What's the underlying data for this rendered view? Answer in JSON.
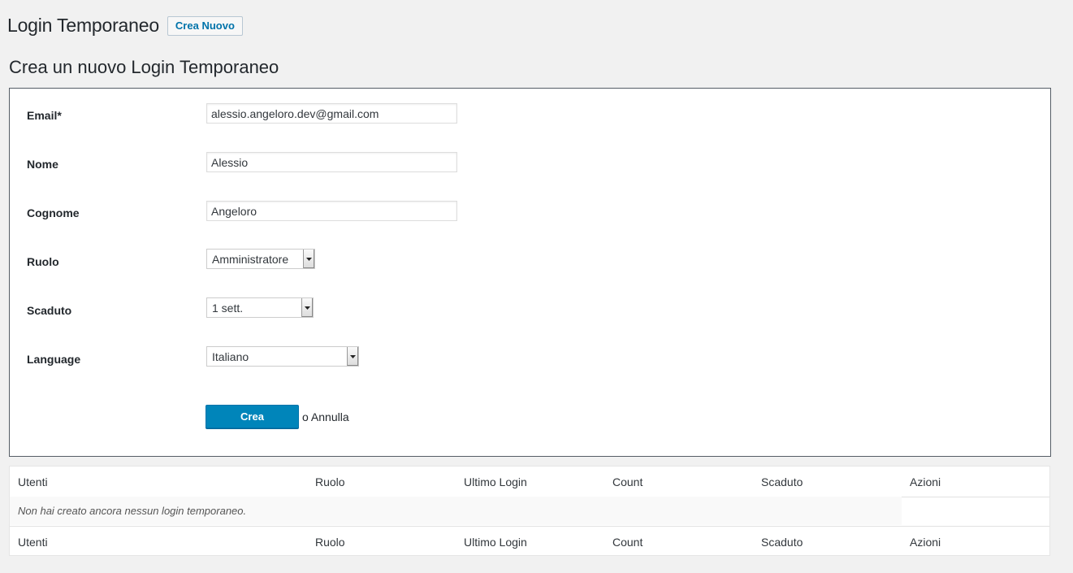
{
  "header": {
    "title": "Login Temporaneo",
    "add_new_label": "Crea Nuovo"
  },
  "form": {
    "title": "Crea un nuovo Login Temporaneo",
    "fields": {
      "email": {
        "label": "Email*",
        "value": "alessio.angeloro.dev@gmail.com"
      },
      "nome": {
        "label": "Nome",
        "value": "Alessio"
      },
      "cognome": {
        "label": "Cognome",
        "value": "Angeloro"
      },
      "ruolo": {
        "label": "Ruolo",
        "value": "Amministratore"
      },
      "scaduto": {
        "label": "Scaduto",
        "value": "1 sett."
      },
      "language": {
        "label": "Language",
        "value": "Italiano"
      }
    },
    "submit_label": "Crea",
    "or_label": "o",
    "cancel_label": "Annulla"
  },
  "table": {
    "columns": [
      "Utenti",
      "Ruolo",
      "Ultimo Login",
      "Count",
      "Scaduto",
      "Azioni"
    ],
    "empty_message": "Non hai creato ancora nessun login temporaneo."
  },
  "colors": {
    "primary": "#0085ba",
    "link": "#0073aa",
    "background": "#f1f1f1"
  },
  "icons": {
    "select_arrow": "caret-down-icon"
  }
}
